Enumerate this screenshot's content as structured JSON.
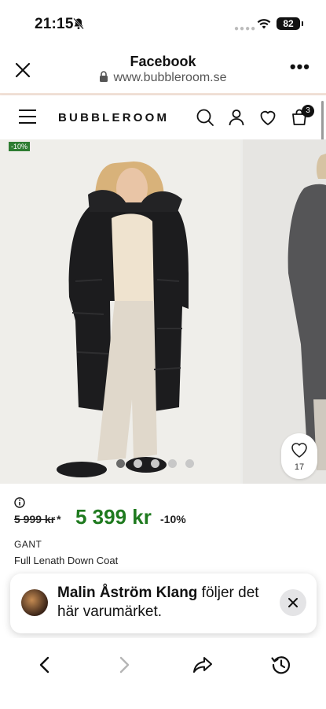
{
  "status": {
    "time": "21:15",
    "battery": "82",
    "bell_icon": "bell-muted-icon",
    "wifi_icon": "wifi-icon"
  },
  "browser": {
    "title": "Facebook",
    "url": "www.bubbleroom.se",
    "close_icon": "close-icon",
    "more_icon": "more-icon"
  },
  "site": {
    "logo": "BUBBLEROOM",
    "cart_count": "3",
    "icons": [
      "menu-icon",
      "search-icon",
      "user-icon",
      "heart-icon",
      "bag-icon"
    ]
  },
  "product": {
    "discount_tag": "-10%",
    "wishlist_count": "17",
    "gallery_dots": 5,
    "active_dot": 0,
    "old_price": "5 999 kr",
    "old_price_mark": "*",
    "new_price": "5 399 kr",
    "percent": "-10%",
    "brand": "GANT",
    "name": "Full Lenath Down Coat"
  },
  "toast": {
    "name": "Malin Åström Klang",
    "message": " följer det här varumärket."
  },
  "colors": {
    "price_green": "#1f7a1f",
    "tag_green": "#2e7d32",
    "accent_strip": "#f3e2d8"
  }
}
